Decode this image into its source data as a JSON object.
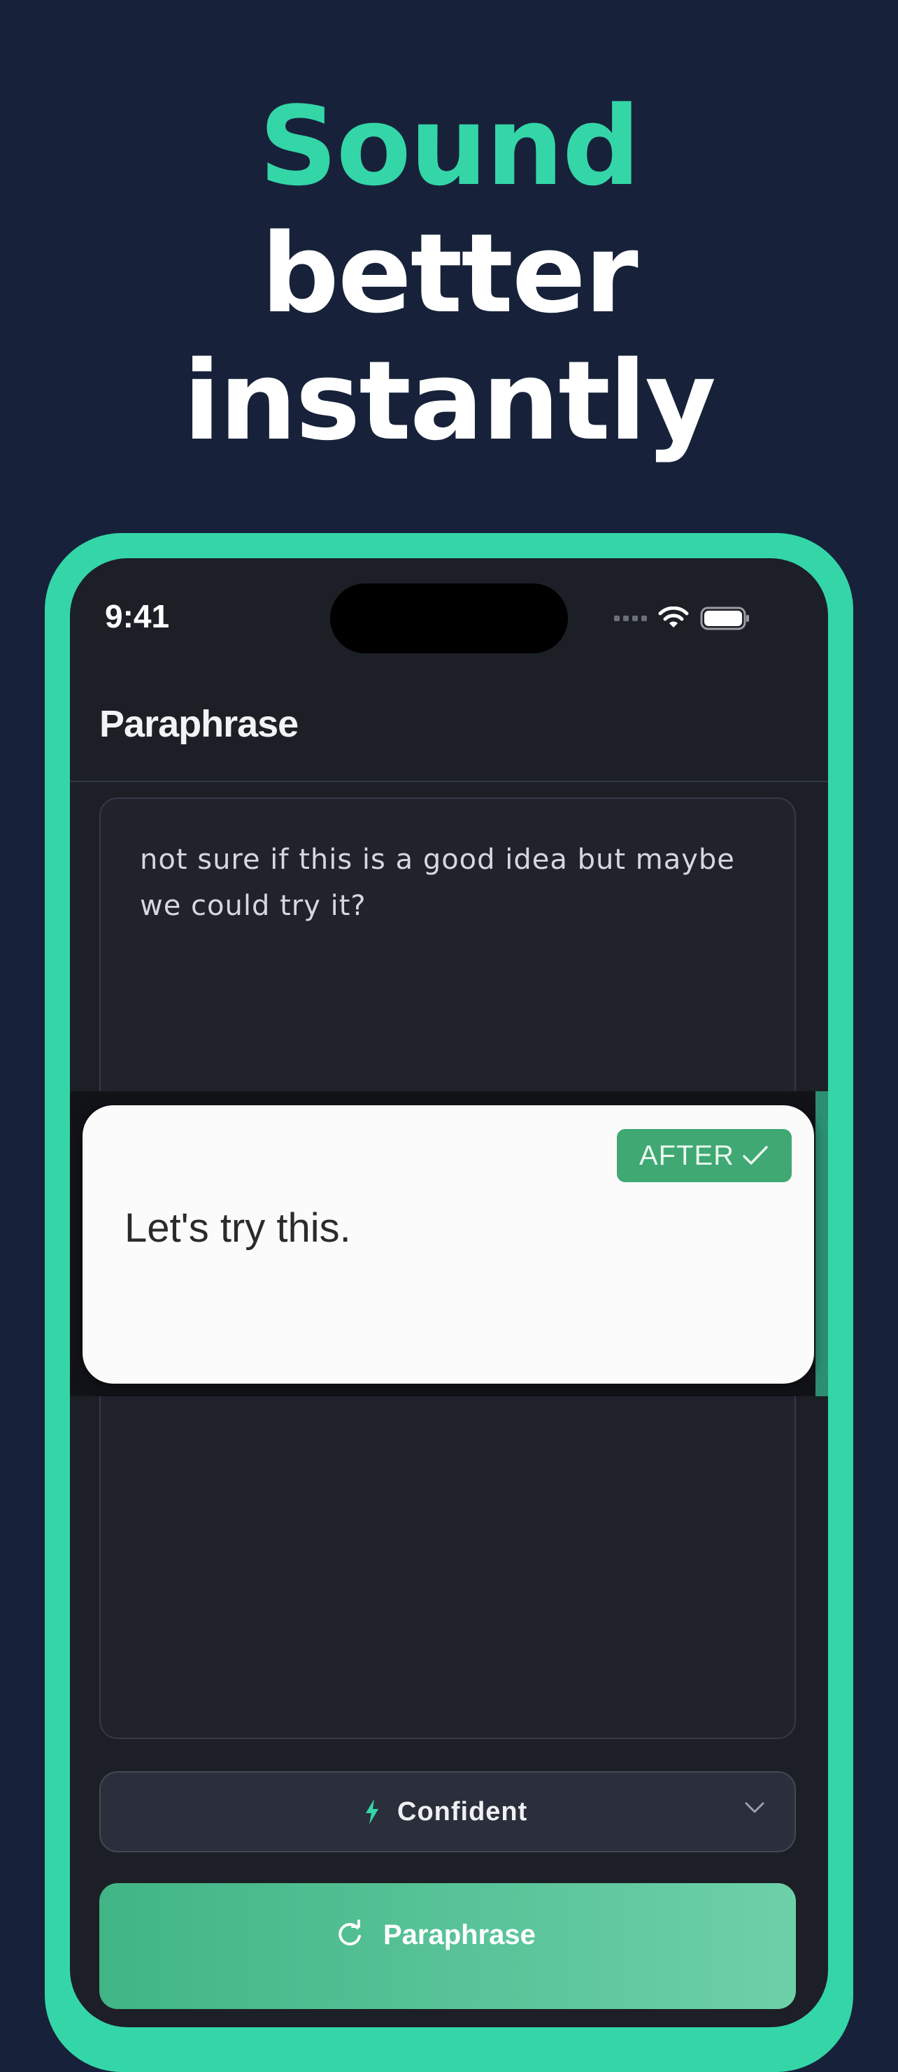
{
  "headline": {
    "line1": "Sound",
    "line2": "better",
    "line3": "instantly"
  },
  "status_bar": {
    "time": "9:41"
  },
  "nav": {
    "title": "Paraphrase"
  },
  "input": {
    "text": "not sure if this is a good idea but maybe we could try it?"
  },
  "after_card": {
    "badge_label": "AFTER",
    "badge_icon": "check-icon",
    "result_text": "Let's try this."
  },
  "tone_select": {
    "selected": "Confident",
    "icon": "bolt-icon"
  },
  "action_button": {
    "label": "Paraphrase",
    "icon": "refresh-icon"
  },
  "colors": {
    "background": "#17223a",
    "accent": "#34d6a8",
    "screen": "#1d1f27",
    "badge": "#3fa873"
  }
}
